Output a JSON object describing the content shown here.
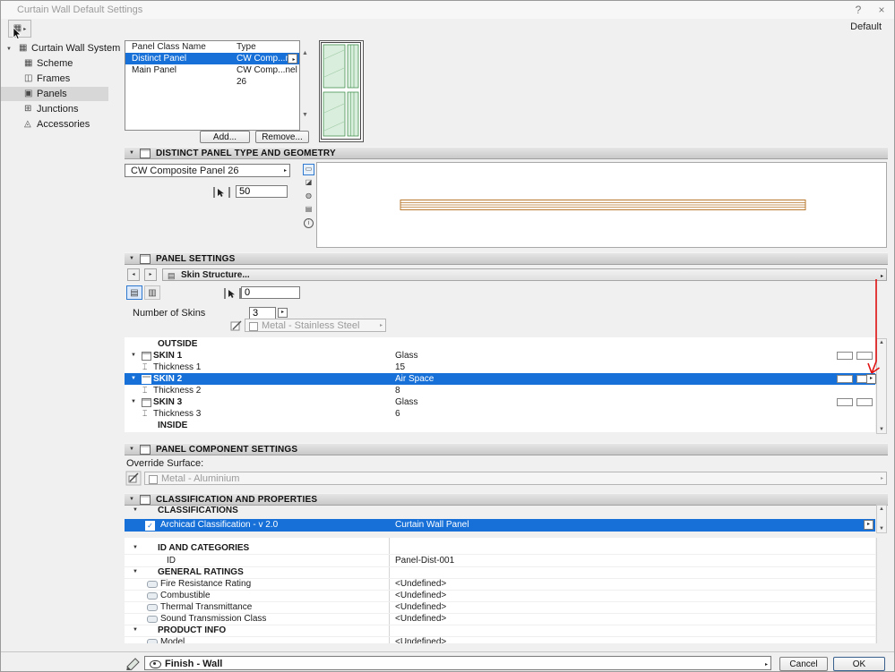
{
  "window": {
    "title": "Curtain Wall Default Settings",
    "default_label": "Default",
    "help_label": "?",
    "close_label": "×"
  },
  "icons": {
    "tri_down": "▼",
    "tri_right": "▸",
    "tri_left": "◂",
    "tri_up": "▲",
    "check": "✓",
    "grid": "▦",
    "layers": "▤",
    "layers_alt": "▥",
    "frame": "◫",
    "panel": "▣",
    "junction": "⊞",
    "accessory": "◬",
    "thickness": "⌶",
    "info": "i"
  },
  "sidebar": {
    "root_label": "Curtain Wall System",
    "items": [
      {
        "label": "Scheme"
      },
      {
        "label": "Frames"
      },
      {
        "label": "Panels"
      },
      {
        "label": "Junctions"
      },
      {
        "label": "Accessories"
      }
    ]
  },
  "panel_table": {
    "col_name": "Panel Class Name",
    "col_type": "Type",
    "rows": [
      {
        "name": "Distinct Panel",
        "type": "CW Comp...nel 26"
      },
      {
        "name": "Main Panel",
        "type": "CW Comp...nel 26"
      }
    ],
    "add_label": "Add...",
    "remove_label": "Remove..."
  },
  "geometry": {
    "title": "DISTINCT PANEL TYPE AND GEOMETRY",
    "panel_type": "CW Composite Panel 26",
    "thickness": "50"
  },
  "panel_settings": {
    "title": "PANEL SETTINGS",
    "tab_label": "Skin Structure...",
    "offset_value": "0",
    "skins_count_label": "Number of Skins",
    "skins_count": "3",
    "surface_value": "Metal - Stainless Steel",
    "outside_label": "OUTSIDE",
    "inside_label": "INSIDE",
    "skins": [
      {
        "label": "SKIN 1",
        "material": "Glass",
        "thickness_label": "Thickness 1",
        "thickness": "15"
      },
      {
        "label": "SKIN 2",
        "material": "Air Space",
        "thickness_label": "Thickness 2",
        "thickness": "8"
      },
      {
        "label": "SKIN 3",
        "material": "Glass",
        "thickness_label": "Thickness 3",
        "thickness": "6"
      }
    ]
  },
  "component": {
    "title": "PANEL COMPONENT SETTINGS",
    "override_label": "Override Surface:",
    "surface_value": "Metal - Aluminium"
  },
  "classification": {
    "title": "CLASSIFICATION AND PROPERTIES",
    "subheader": "CLASSIFICATIONS",
    "system_name": "Archicad Classification - v 2.0",
    "system_value": "Curtain Wall Panel",
    "group_id_label": "ID AND CATEGORIES",
    "id_label": "ID",
    "id_value": "Panel-Dist-001",
    "group_ratings_label": "GENERAL RATINGS",
    "ratings": [
      {
        "name": "Fire Resistance Rating",
        "value": "<Undefined>"
      },
      {
        "name": "Combustible",
        "value": "<Undefined>"
      },
      {
        "name": "Thermal Transmittance",
        "value": "<Undefined>"
      },
      {
        "name": "Sound Transmission Class",
        "value": "<Undefined>"
      }
    ],
    "group_product_label": "PRODUCT INFO",
    "model_label": "Model",
    "model_value": "<Undefined>"
  },
  "footer": {
    "layer_value": "Finish - Wall",
    "cancel_label": "Cancel",
    "ok_label": "OK"
  },
  "colors": {
    "selection": "#1670d8",
    "annotation_red": "#e01010",
    "panel_green": "#daeedd",
    "section_orange": "#b8792e"
  }
}
